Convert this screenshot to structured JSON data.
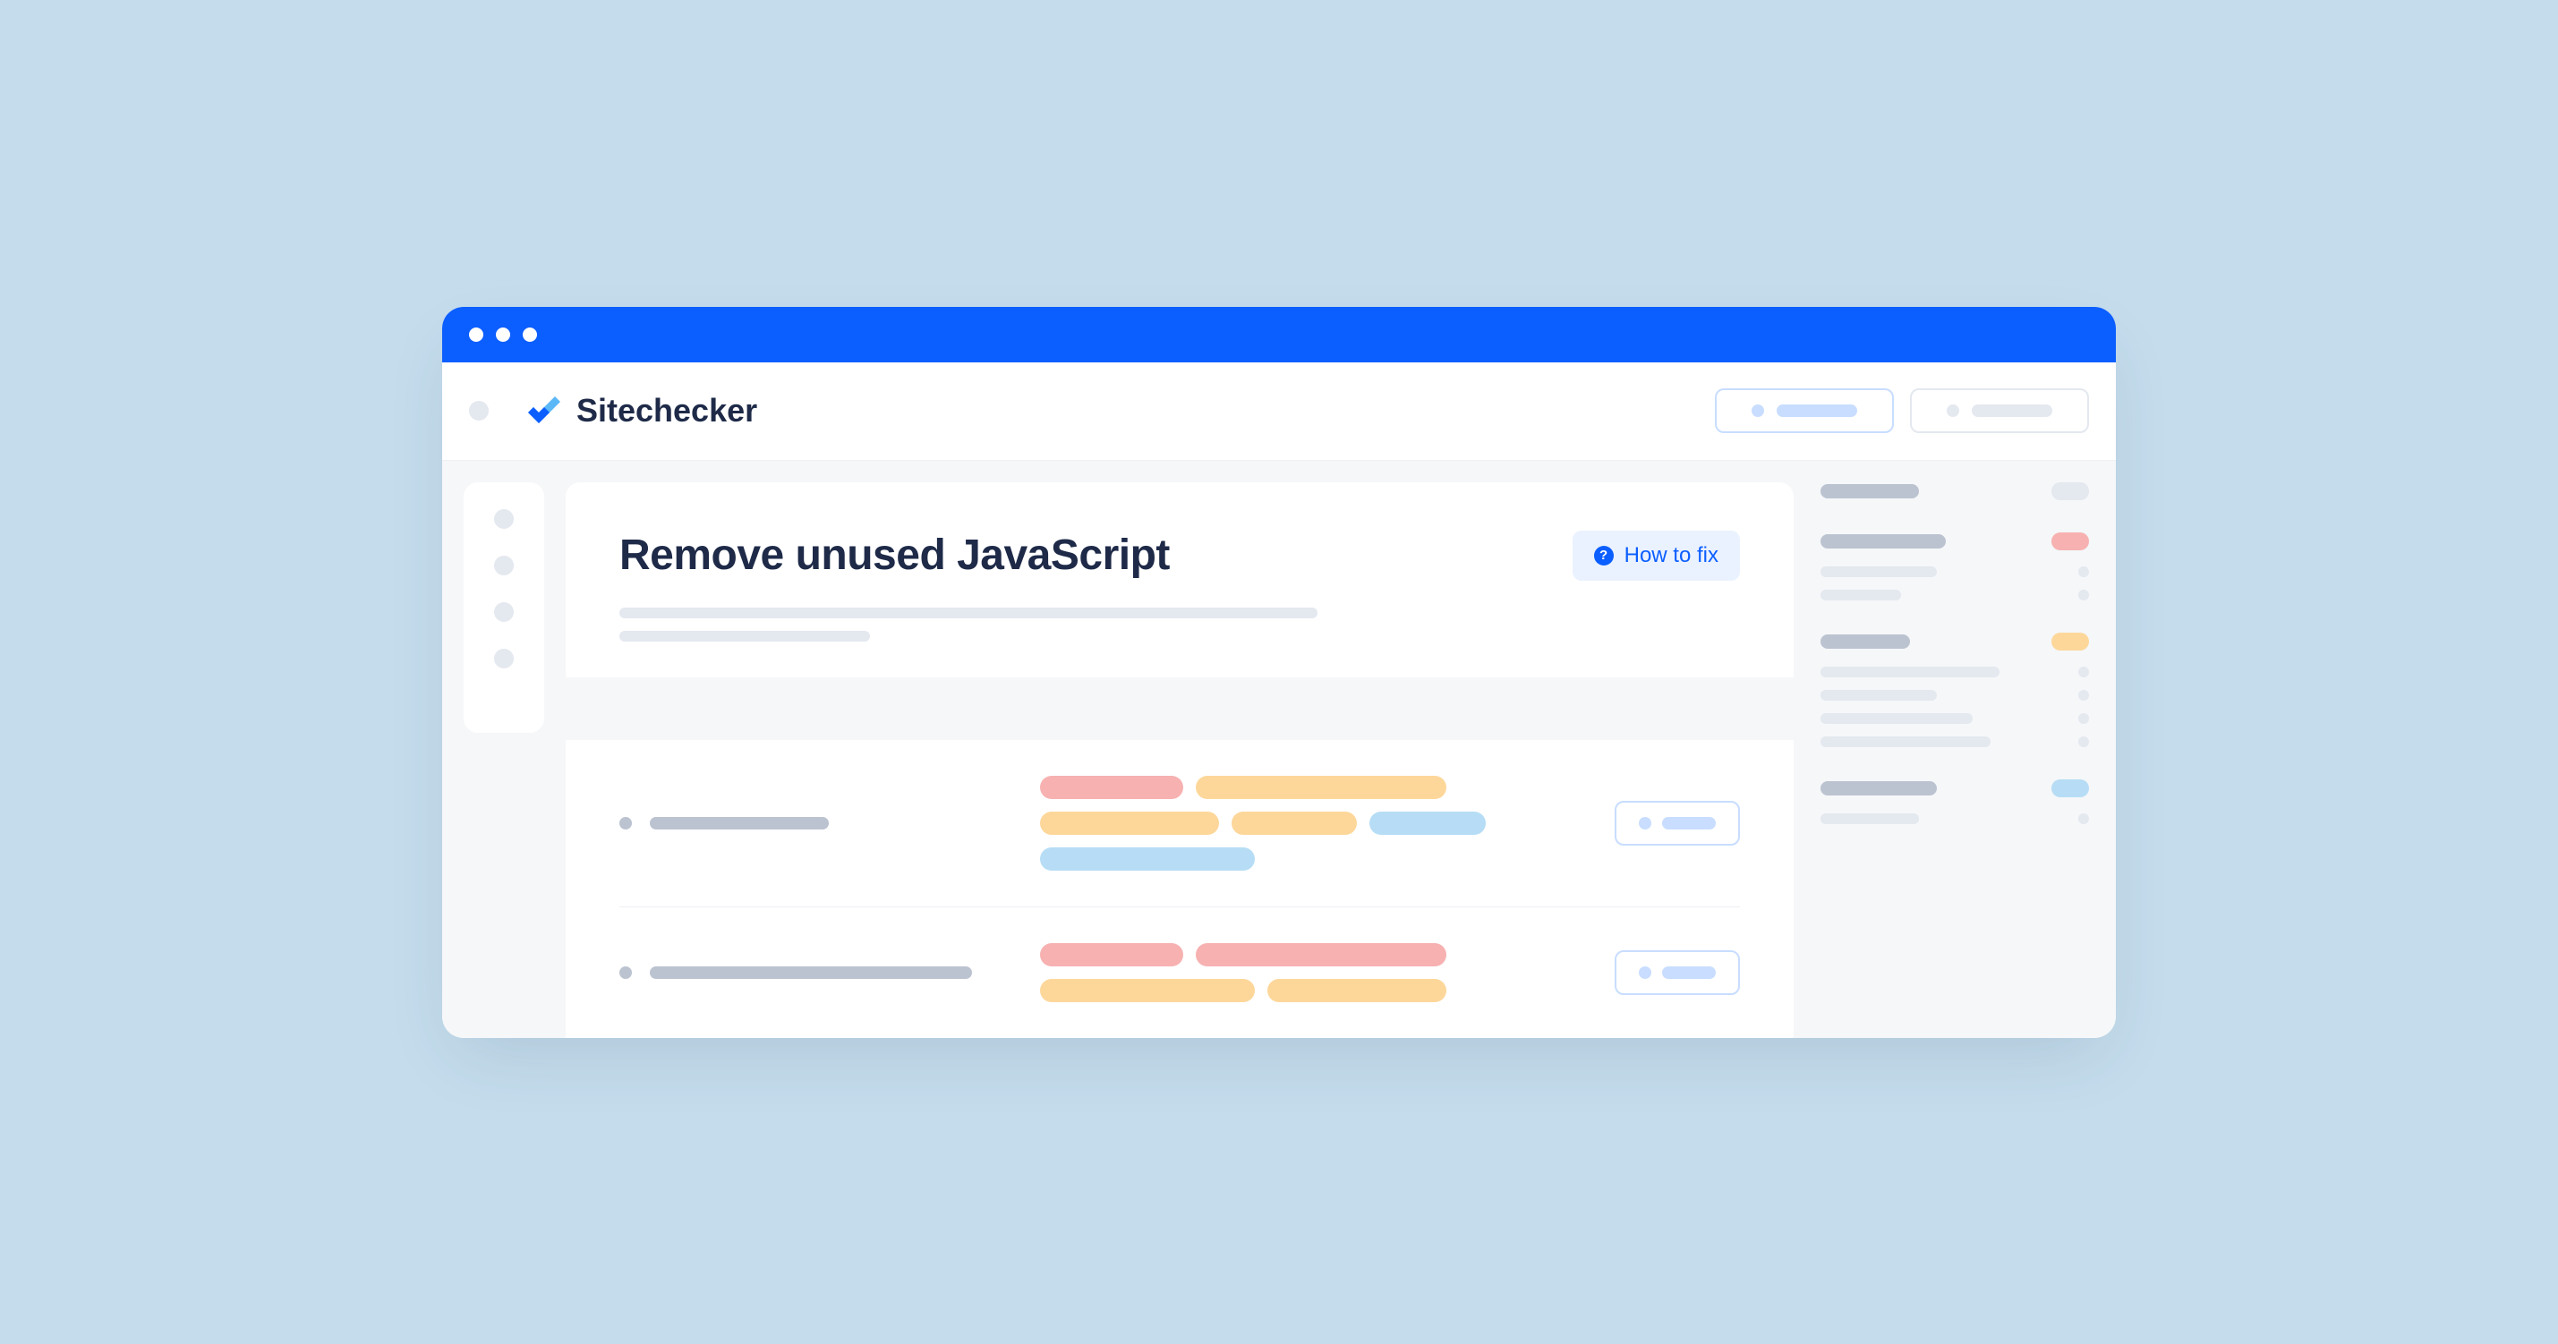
{
  "brand": {
    "name": "Sitechecker"
  },
  "card": {
    "title": "Remove unused JavaScript",
    "howto_label": "How to fix"
  }
}
